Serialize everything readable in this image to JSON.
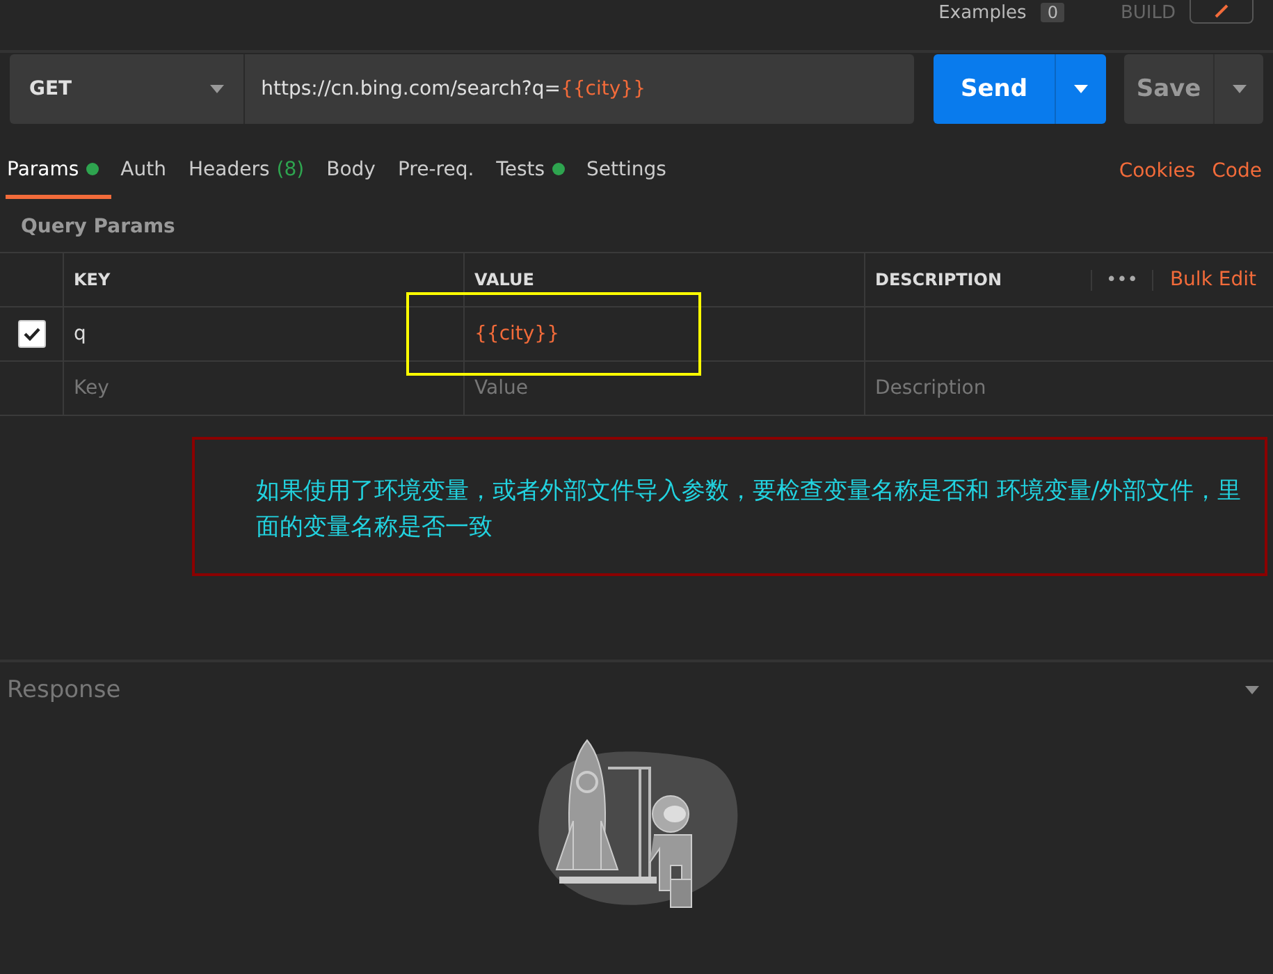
{
  "header": {
    "examples_label": "Examples",
    "examples_count": "0",
    "mode": "BUILD"
  },
  "request": {
    "method": "GET",
    "url_base": "https://cn.bing.com/search?q=",
    "url_variable": "{{city}}",
    "send": "Send",
    "save": "Save"
  },
  "tabs": [
    {
      "label": "Params",
      "selected": true,
      "dot": true
    },
    {
      "label": "Auth",
      "selected": false,
      "dot": false
    },
    {
      "label": "Headers",
      "count": "(8)",
      "selected": false,
      "dot": false
    },
    {
      "label": "Body",
      "selected": false,
      "dot": false
    },
    {
      "label": "Pre-req.",
      "selected": false,
      "dot": false
    },
    {
      "label": "Tests",
      "selected": false,
      "dot": true
    },
    {
      "label": "Settings",
      "selected": false,
      "dot": false
    }
  ],
  "right_links": [
    "Cookies",
    "Code"
  ],
  "params": {
    "title": "Query Params",
    "columns": [
      "KEY",
      "VALUE",
      "DESCRIPTION"
    ],
    "more": "•••",
    "bulk_edit": "Bulk Edit",
    "rows": [
      {
        "checked": true,
        "key": "q",
        "value": "{{city}}"
      }
    ],
    "placeholders": {
      "key": "Key",
      "value": "Value",
      "description": "Description"
    }
  },
  "annotation": "如果使用了环境变量，或者外部文件导入参数，要检查变量名称是否和 环境变量/外部文件，里面的变量名称是否一致",
  "response": {
    "title": "Response"
  }
}
